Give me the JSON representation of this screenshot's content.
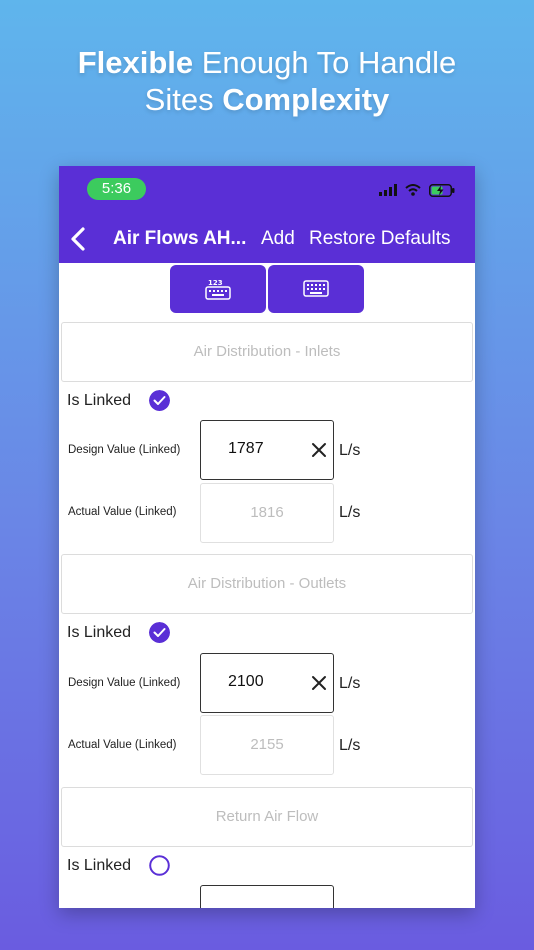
{
  "headline": {
    "line1_bold": "Flexible",
    "line1_rest": " Enough To Handle",
    "line2_start": "Sites ",
    "line2_bold": "Complexity"
  },
  "status_bar": {
    "time": "5:36"
  },
  "nav": {
    "title": "Air Flows AH...",
    "add_label": "Add",
    "restore_label": "Restore Defaults"
  },
  "keyboard_buttons": [
    {
      "icon": "numeric-keypad-icon"
    },
    {
      "icon": "keyboard-icon"
    }
  ],
  "sections": [
    {
      "title": "Air Distribution - Inlets",
      "is_linked_label": "Is Linked",
      "is_linked": true,
      "design_label": "Design Value (Linked)",
      "design_value": "1787",
      "actual_label": "Actual Value (Linked)",
      "actual_value": "1816",
      "unit": "L/s"
    },
    {
      "title": "Air Distribution - Outlets",
      "is_linked_label": "Is Linked",
      "is_linked": true,
      "design_label": "Design Value (Linked)",
      "design_value": "2100",
      "actual_label": "Actual Value (Linked)",
      "actual_value": "2155",
      "unit": "L/s"
    },
    {
      "title": "Return Air Flow",
      "is_linked_label": "Is Linked",
      "is_linked": false
    }
  ],
  "colors": {
    "accent": "#5a2fd6",
    "time_pill": "#3ccb5e"
  }
}
